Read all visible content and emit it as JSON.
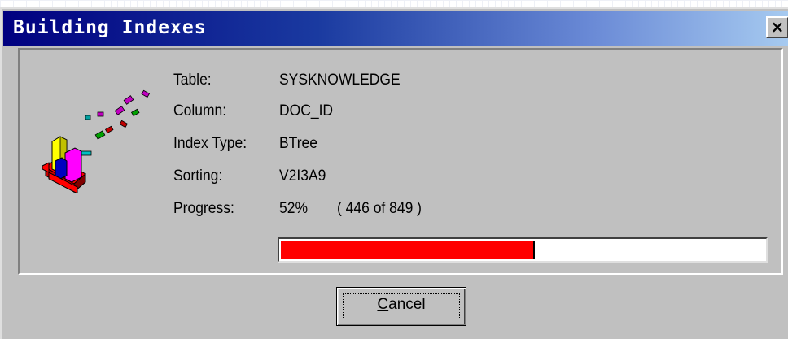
{
  "window": {
    "title": "Building Indexes",
    "close_glyph": "✕"
  },
  "details": {
    "table_label": "Table:",
    "table_value": "SYSKNOWLEDGE",
    "column_label": "Column:",
    "column_value": "DOC_ID",
    "index_type_label": "Index Type:",
    "index_type_value": "BTree",
    "sorting_label": "Sorting:",
    "sorting_value": "V2I3A9",
    "progress_label": "Progress:",
    "progress_percent": "52%",
    "progress_count": "( 446 of 849 )"
  },
  "progress": {
    "current": 446,
    "total": 849,
    "fill_color": "#ff0000"
  },
  "buttons": {
    "cancel_first": "C",
    "cancel_rest": "ancel"
  },
  "icons": {
    "dialog_icon": "index-building-icon"
  },
  "colors": {
    "titlebar_start": "#000080",
    "titlebar_end": "#a6caf0",
    "face": "#c0c0c0"
  }
}
